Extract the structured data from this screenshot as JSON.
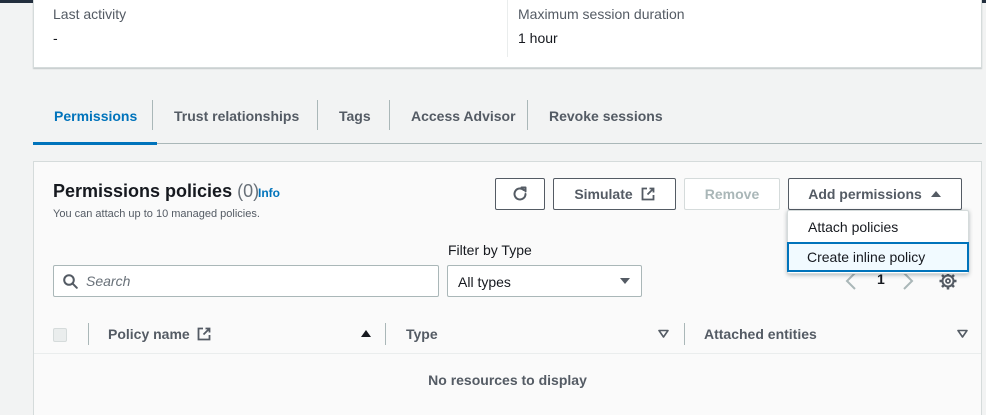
{
  "summary": {
    "left": {
      "label": "Last activity",
      "value": "-"
    },
    "right": {
      "label": "Maximum session duration",
      "value": "1 hour"
    }
  },
  "tabs": [
    {
      "label": "Permissions",
      "active": true
    },
    {
      "label": "Trust relationships",
      "active": false
    },
    {
      "label": "Tags",
      "active": false
    },
    {
      "label": "Access Advisor",
      "active": false
    },
    {
      "label": "Revoke sessions",
      "active": false
    }
  ],
  "panel": {
    "title": "Permissions policies",
    "count": "(0)",
    "info": "Info",
    "description": "You can attach up to 10 managed policies."
  },
  "toolbar": {
    "simulate_label": "Simulate",
    "remove_label": "Remove",
    "add_permissions_label": "Add permissions"
  },
  "dropdown": {
    "items": [
      {
        "label": "Attach policies"
      },
      {
        "label": "Create inline policy"
      }
    ]
  },
  "filter": {
    "search_placeholder": "Search",
    "type_label": "Filter by Type",
    "type_value": "All types"
  },
  "pagination": {
    "page": "1"
  },
  "table": {
    "columns": [
      {
        "label": "Policy name"
      },
      {
        "label": "Type"
      },
      {
        "label": "Attached entities"
      }
    ],
    "empty_message": "No resources to display"
  },
  "colors": {
    "accent": "#0073bb",
    "text": "#16191f",
    "muted": "#545b64",
    "border": "#aab7b8",
    "background": "#f2f3f3"
  },
  "icons": [
    "refresh-icon",
    "external-link-icon",
    "caret-up-icon",
    "caret-down-icon",
    "search-icon",
    "chevron-left-icon",
    "chevron-right-icon",
    "gear-icon"
  ]
}
